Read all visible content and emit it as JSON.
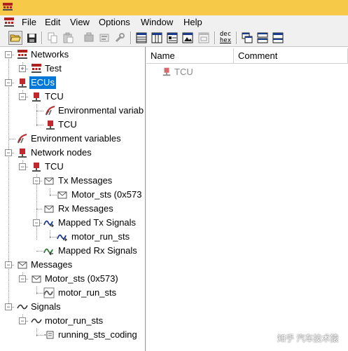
{
  "menu": {
    "file": "File",
    "edit": "Edit",
    "view": "View",
    "options": "Options",
    "window": "Window",
    "help": "Help"
  },
  "toolbar": {
    "dechex_top": "dec",
    "dechex_bottom": "hex"
  },
  "tree": {
    "networks": "Networks",
    "test": "Test",
    "ecus": "ECUs",
    "tcu": "TCU",
    "environmental_variables": "Environmental variab",
    "tcu_ecu": "TCU",
    "env_variables": "Environment variables",
    "network_nodes": "Network nodes",
    "nn_tcu": "TCU",
    "tx_messages": "Tx Messages",
    "motor_sts_tx": "Motor_sts (0x573",
    "rx_messages": "Rx Messages",
    "mapped_tx_signals": "Mapped Tx Signals",
    "motor_run_sts_mapped": "motor_run_sts",
    "mapped_rx_signals": "Mapped Rx Signals",
    "messages": "Messages",
    "motor_sts_msg": "Motor_sts (0x573)",
    "motor_run_sts_msg": "motor_run_sts",
    "signals": "Signals",
    "motor_run_sts_sig": "motor_run_sts",
    "running_sts_coding": "running_sts_coding"
  },
  "list": {
    "col_name": "Name",
    "col_comment": "Comment",
    "rows": [
      {
        "name": "TCU",
        "comment": ""
      }
    ]
  },
  "watermark": "知乎 汽车技术猿",
  "colors": {
    "titlebar": "#f7c948",
    "selection": "#0078d7",
    "ecu_icon": "#c0282d"
  }
}
